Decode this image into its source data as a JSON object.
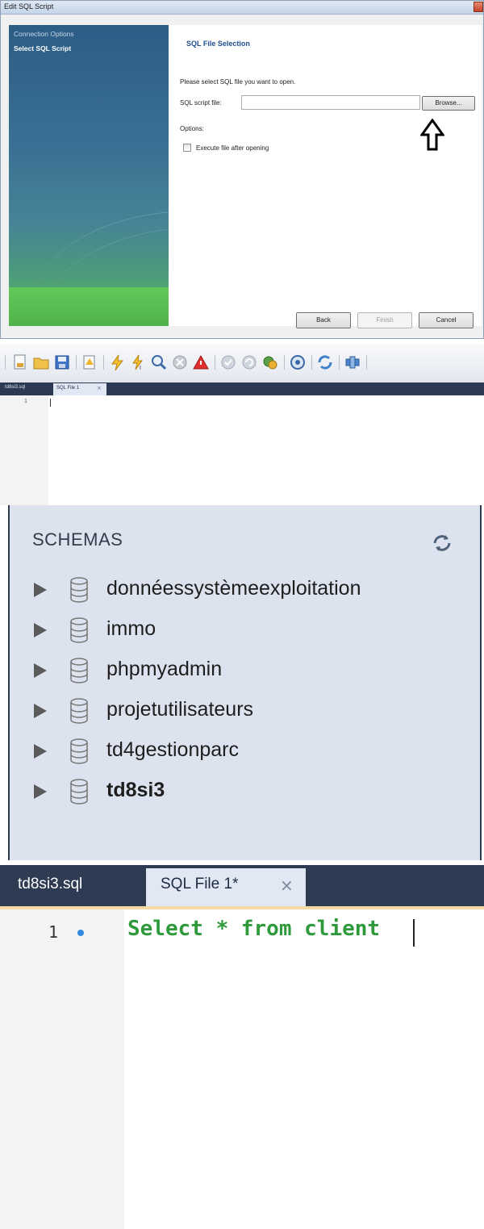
{
  "dialog": {
    "title": "Edit SQL Script",
    "sidebar": {
      "items": [
        {
          "label": "Connection Options"
        },
        {
          "label": "Select SQL Script"
        }
      ]
    },
    "heading": "SQL File Selection",
    "prompt": "Please select SQL file you want to open.",
    "file_label": "SQL script file:",
    "file_value": "",
    "browse_label": "Browse...",
    "options_label": "Options:",
    "execute_label": "Execute file after opening",
    "execute_checked": false,
    "buttons": {
      "back": "Back",
      "finish": "Finish",
      "cancel": "Cancel"
    }
  },
  "small_editor": {
    "tabs": [
      {
        "label": "td8si3.sql"
      },
      {
        "label": "SQL File 1",
        "close": "×"
      }
    ],
    "line_number": "1"
  },
  "schemas": {
    "title": "SCHEMAS",
    "items": [
      {
        "name": "donnéessystèmeexploitation",
        "bold": false
      },
      {
        "name": "immo",
        "bold": false
      },
      {
        "name": "phpmyadmin",
        "bold": false
      },
      {
        "name": "projetutilisateurs",
        "bold": false
      },
      {
        "name": "td4gestionparc",
        "bold": false
      },
      {
        "name": "td8si3",
        "bold": true
      }
    ]
  },
  "editor": {
    "tabs": [
      {
        "label": "td8si3.sql"
      },
      {
        "label": "SQL File 1*",
        "close": "×"
      }
    ],
    "line_number": "1",
    "code": "Select * from client",
    "code_color": "#2f9a3c"
  }
}
